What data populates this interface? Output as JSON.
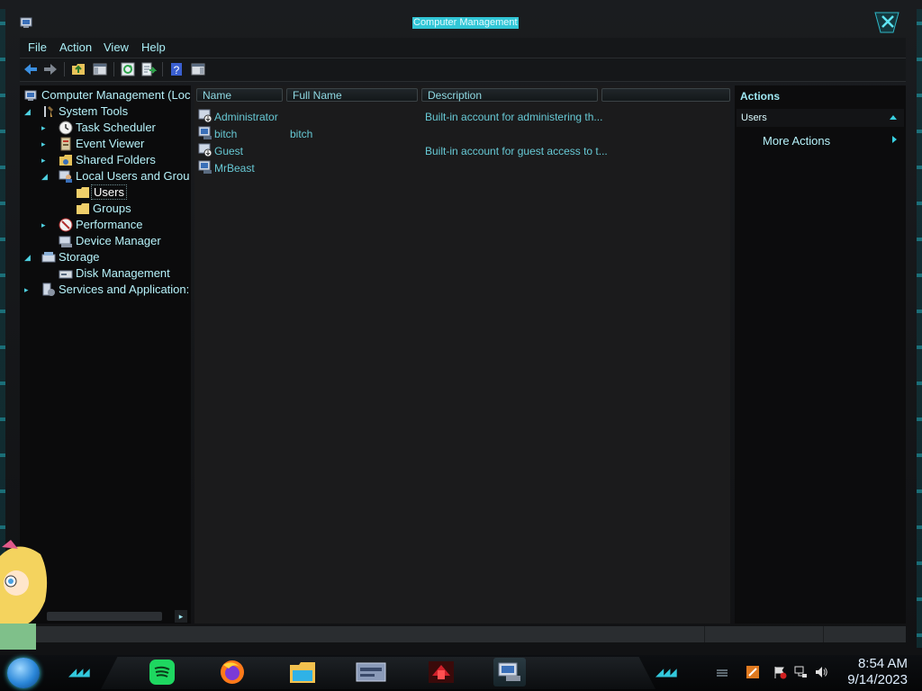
{
  "window": {
    "title": "Computer Management"
  },
  "menu": [
    "File",
    "Action",
    "View",
    "Help"
  ],
  "tree": [
    {
      "label": "Computer Management (Loc",
      "icon": "computer-management-icon",
      "expander": "",
      "depth": 0
    },
    {
      "label": "System Tools",
      "icon": "tools-icon",
      "expander": "expanded",
      "depth": 1
    },
    {
      "label": "Task Scheduler",
      "icon": "clock-icon",
      "expander": "collapsed",
      "depth": 2
    },
    {
      "label": "Event Viewer",
      "icon": "event-viewer-icon",
      "expander": "collapsed",
      "depth": 2
    },
    {
      "label": "Shared Folders",
      "icon": "shared-folder-icon",
      "expander": "collapsed",
      "depth": 2
    },
    {
      "label": "Local Users and Grou",
      "icon": "users-icon",
      "expander": "expanded",
      "depth": 2
    },
    {
      "label": "Users",
      "icon": "folder-icon",
      "expander": "",
      "depth": 3,
      "selected": true
    },
    {
      "label": "Groups",
      "icon": "folder-icon",
      "expander": "",
      "depth": 3
    },
    {
      "label": "Performance",
      "icon": "performance-icon",
      "expander": "collapsed",
      "depth": 2
    },
    {
      "label": "Device Manager",
      "icon": "device-manager-icon",
      "expander": "",
      "depth": 2
    },
    {
      "label": "Storage",
      "icon": "storage-icon",
      "expander": "expanded",
      "depth": 1
    },
    {
      "label": "Disk Management",
      "icon": "disk-icon",
      "expander": "",
      "depth": 2
    },
    {
      "label": "Services and Application:",
      "icon": "services-icon",
      "expander": "collapsed",
      "depth": 1
    }
  ],
  "list": {
    "columns": [
      "Name",
      "Full Name",
      "Description",
      ""
    ],
    "rows": [
      {
        "name": "Administrator",
        "full_name": "",
        "description": "Built-in account for administering th...",
        "disabled": true
      },
      {
        "name": "bitch",
        "full_name": "bitch",
        "description": "",
        "disabled": false
      },
      {
        "name": "Guest",
        "full_name": "",
        "description": "Built-in account for guest access to t...",
        "disabled": true
      },
      {
        "name": "MrBeast",
        "full_name": "",
        "description": "",
        "disabled": false
      }
    ]
  },
  "actions": {
    "title": "Actions",
    "section": "Users",
    "more": "More Actions"
  },
  "taskbar": {
    "apps": [
      "spotify-icon",
      "firefox-icon",
      "file-explorer-icon",
      "app-window-icon",
      "red-app-icon",
      "computer-management-icon"
    ],
    "time": "8:54 AM",
    "date": "9/14/2023"
  },
  "colors": {
    "accent": "#39d0e0",
    "text": "#b6f2fa",
    "list_text": "#67c9d5",
    "background": "#1b1b1c"
  }
}
